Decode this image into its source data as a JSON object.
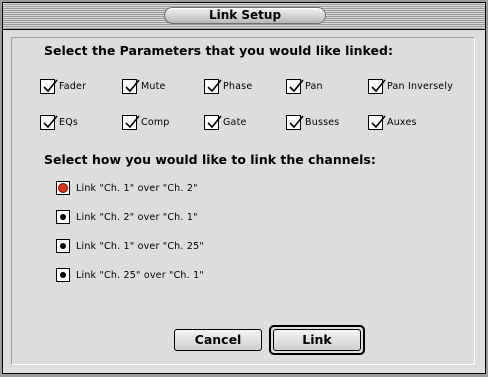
{
  "window": {
    "title": "Link Setup"
  },
  "parameters_section": {
    "heading": "Select the Parameters that you would like linked:",
    "checkboxes": [
      {
        "label": "Fader",
        "checked": true
      },
      {
        "label": "Mute",
        "checked": true
      },
      {
        "label": "Phase",
        "checked": true
      },
      {
        "label": "Pan",
        "checked": true
      },
      {
        "label": "Pan Inversely",
        "checked": true
      },
      {
        "label": "EQs",
        "checked": true
      },
      {
        "label": "Comp",
        "checked": true
      },
      {
        "label": "Gate",
        "checked": true
      },
      {
        "label": "Busses",
        "checked": true
      },
      {
        "label": "Auxes",
        "checked": true
      }
    ]
  },
  "link_section": {
    "heading": "Select how you would like to link the channels:",
    "options": [
      {
        "label": "Link  \"Ch. 1\" over  \"Ch. 2\"",
        "selected": true
      },
      {
        "label": "Link  \"Ch. 2\" over  \"Ch. 1\"",
        "selected": false
      },
      {
        "label": "Link  \"Ch. 1\" over  \"Ch. 25\"",
        "selected": false
      },
      {
        "label": "Link  \"Ch. 25\" over  \"Ch. 1\"",
        "selected": false
      }
    ]
  },
  "buttons": {
    "cancel_label": "Cancel",
    "link_label": "Link"
  },
  "colors": {
    "dialog_background": "#dddddd",
    "selected_radio": "#e03018"
  }
}
